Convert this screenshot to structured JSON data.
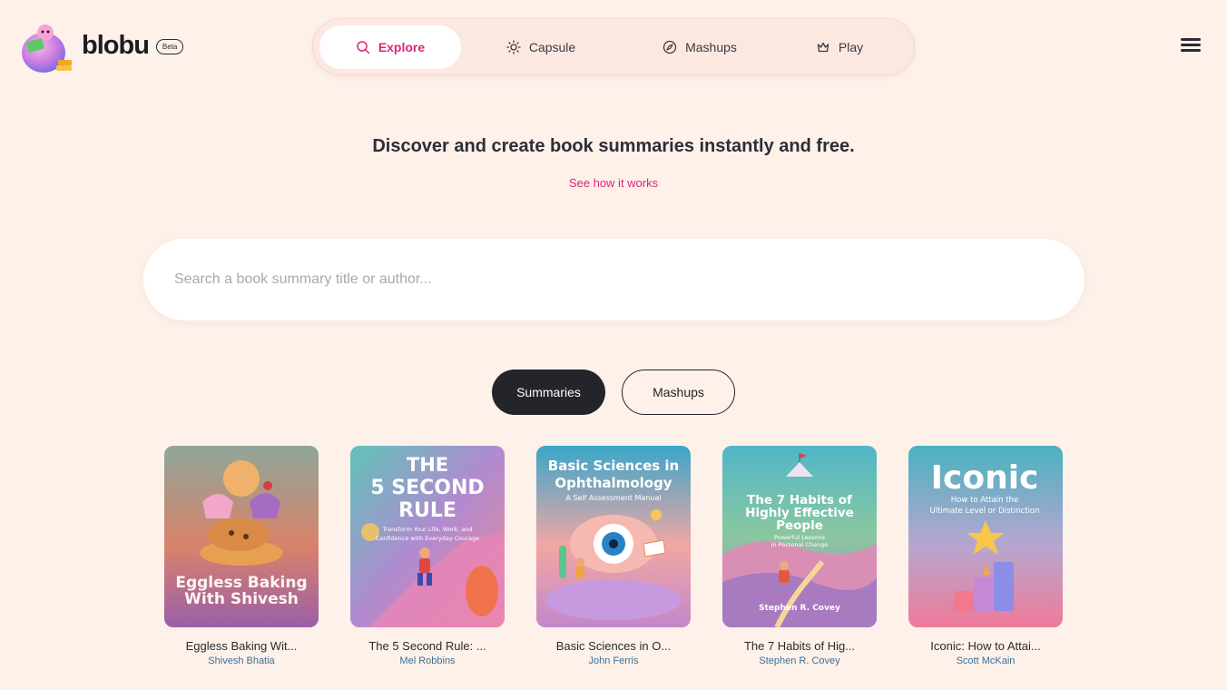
{
  "header": {
    "logo_text": "blobu",
    "badge": "Beta",
    "nav": [
      {
        "label": "Explore",
        "icon": "search-icon",
        "active": true
      },
      {
        "label": "Capsule",
        "icon": "sun-icon",
        "active": false
      },
      {
        "label": "Mashups",
        "icon": "compass-icon",
        "active": false
      },
      {
        "label": "Play",
        "icon": "crown-icon",
        "active": false
      }
    ],
    "menu_icon": "hamburger-menu-icon"
  },
  "hero": {
    "headline": "Discover and create book summaries instantly and free.",
    "link": "See how it works"
  },
  "search": {
    "placeholder": "Search a book summary title or author...",
    "value": ""
  },
  "toggle": {
    "summaries": "Summaries",
    "mashups": "Mashups",
    "selected": "Summaries"
  },
  "books": [
    {
      "title": "Eggless Baking Wit...",
      "author": "Shivesh Bhatia",
      "cover_line1": "Eggless Baking",
      "cover_line2": "With Shivesh"
    },
    {
      "title": "The 5 Second Rule: ...",
      "author": "Mel Robbins",
      "cover_line1": "THE",
      "cover_line2": "5 SECOND",
      "cover_line3": "RULE",
      "cover_sub1": "Transform Your Life, Work, and",
      "cover_sub2": "Confidence with Everyday Courage"
    },
    {
      "title": "Basic Sciences in O...",
      "author": "John Ferris",
      "cover_line1": "Basic Sciences in",
      "cover_line2": "Ophthalmology",
      "cover_sub1": "A Self Assessment Manual"
    },
    {
      "title": "The 7 Habits of Hig...",
      "author": "Stephen R. Covey",
      "cover_line1": "The 7 Habits of",
      "cover_line2": "Highly Effective",
      "cover_line3": "People",
      "cover_sub1": "Powerful Lessons",
      "cover_sub2": "in Personal Change",
      "cover_author": "Stephen R. Covey"
    },
    {
      "title": "Iconic: How to Attai...",
      "author": "Scott McKain",
      "cover_line1": "Iconic",
      "cover_sub1": "How to Attain the",
      "cover_sub2": "Ultimate Level or Distinction"
    }
  ],
  "colors": {
    "background": "#fdf1ea",
    "accent": "#e0257a",
    "dark": "#23252b",
    "author": "#3e6f95"
  }
}
